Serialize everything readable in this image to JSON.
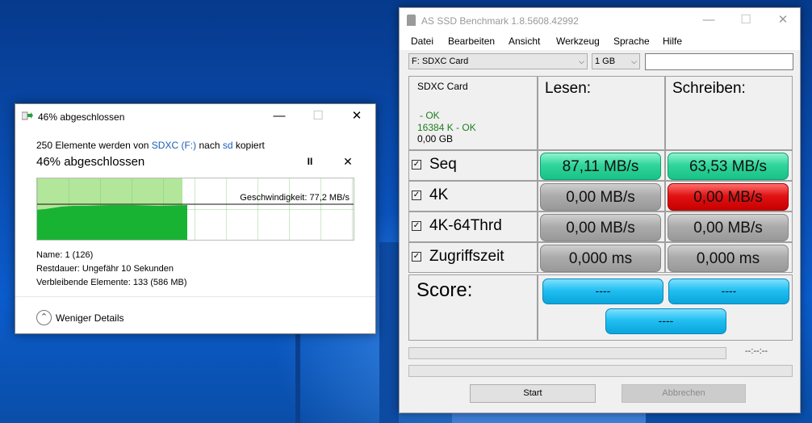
{
  "copy_dialog": {
    "title": "46% abgeschlossen",
    "line_prefix": "250 Elemente werden von",
    "source": "SDXC (F:)",
    "mid": "nach",
    "dest": "sd",
    "suffix": "kopiert",
    "heading": "46% abgeschlossen",
    "progress_fraction": 0.46,
    "speed": "Geschwindigkeit: 77,2 MB/s",
    "name_row": "Name: 1 (126)",
    "remaining_time": "Restdauer: Ungefähr 10 Sekunden",
    "remaining_items": "Verbleibende Elemente: 133 (586 MB)",
    "less_details": "Weniger Details",
    "window_buttons": {
      "minimize": "—",
      "maximize": "☐",
      "close": "✕"
    },
    "pause_symbol": "II",
    "cancel_symbol": "✕"
  },
  "as_ssd": {
    "title": "AS SSD Benchmark 1.8.5608.42992",
    "window_buttons": {
      "minimize": "—",
      "maximize": "☐",
      "close": "✕"
    },
    "menu": [
      "Datei",
      "Bearbeiten",
      "Ansicht",
      "Werkzeug",
      "Sprache",
      "Hilfe"
    ],
    "drive_select": "F: SDXC Card",
    "size_select": "1 GB",
    "dropdown_arrow": "⌵",
    "device": {
      "name": "SDXC Card",
      "ok1": "- OK",
      "ok2": "16384 K - OK",
      "size": "0,00 GB"
    },
    "col_read": "Lesen:",
    "col_write": "Schreiben:",
    "check_mark": "✓",
    "rows": [
      {
        "label": "Seq",
        "read": "87,11 MB/s",
        "write": "63,53 MB/s"
      },
      {
        "label": "4K",
        "read": "0,00 MB/s",
        "write": "0,00 MB/s"
      },
      {
        "label": "4K-64Thrd",
        "read": "0,00 MB/s",
        "write": "0,00 MB/s"
      },
      {
        "label": "Zugriffszeit",
        "read": "0,000 ms",
        "write": "0,000 ms"
      }
    ],
    "score_label": "Score:",
    "score_read": "----",
    "score_write": "----",
    "score_total": "----",
    "timer": "--:--:--",
    "start_button": "Start",
    "abort_button": "Abbrechen",
    "colors": {
      "good": "#30d59c",
      "bad": "#e01313",
      "neutral": "#ababab",
      "score": "#22bff2"
    }
  }
}
